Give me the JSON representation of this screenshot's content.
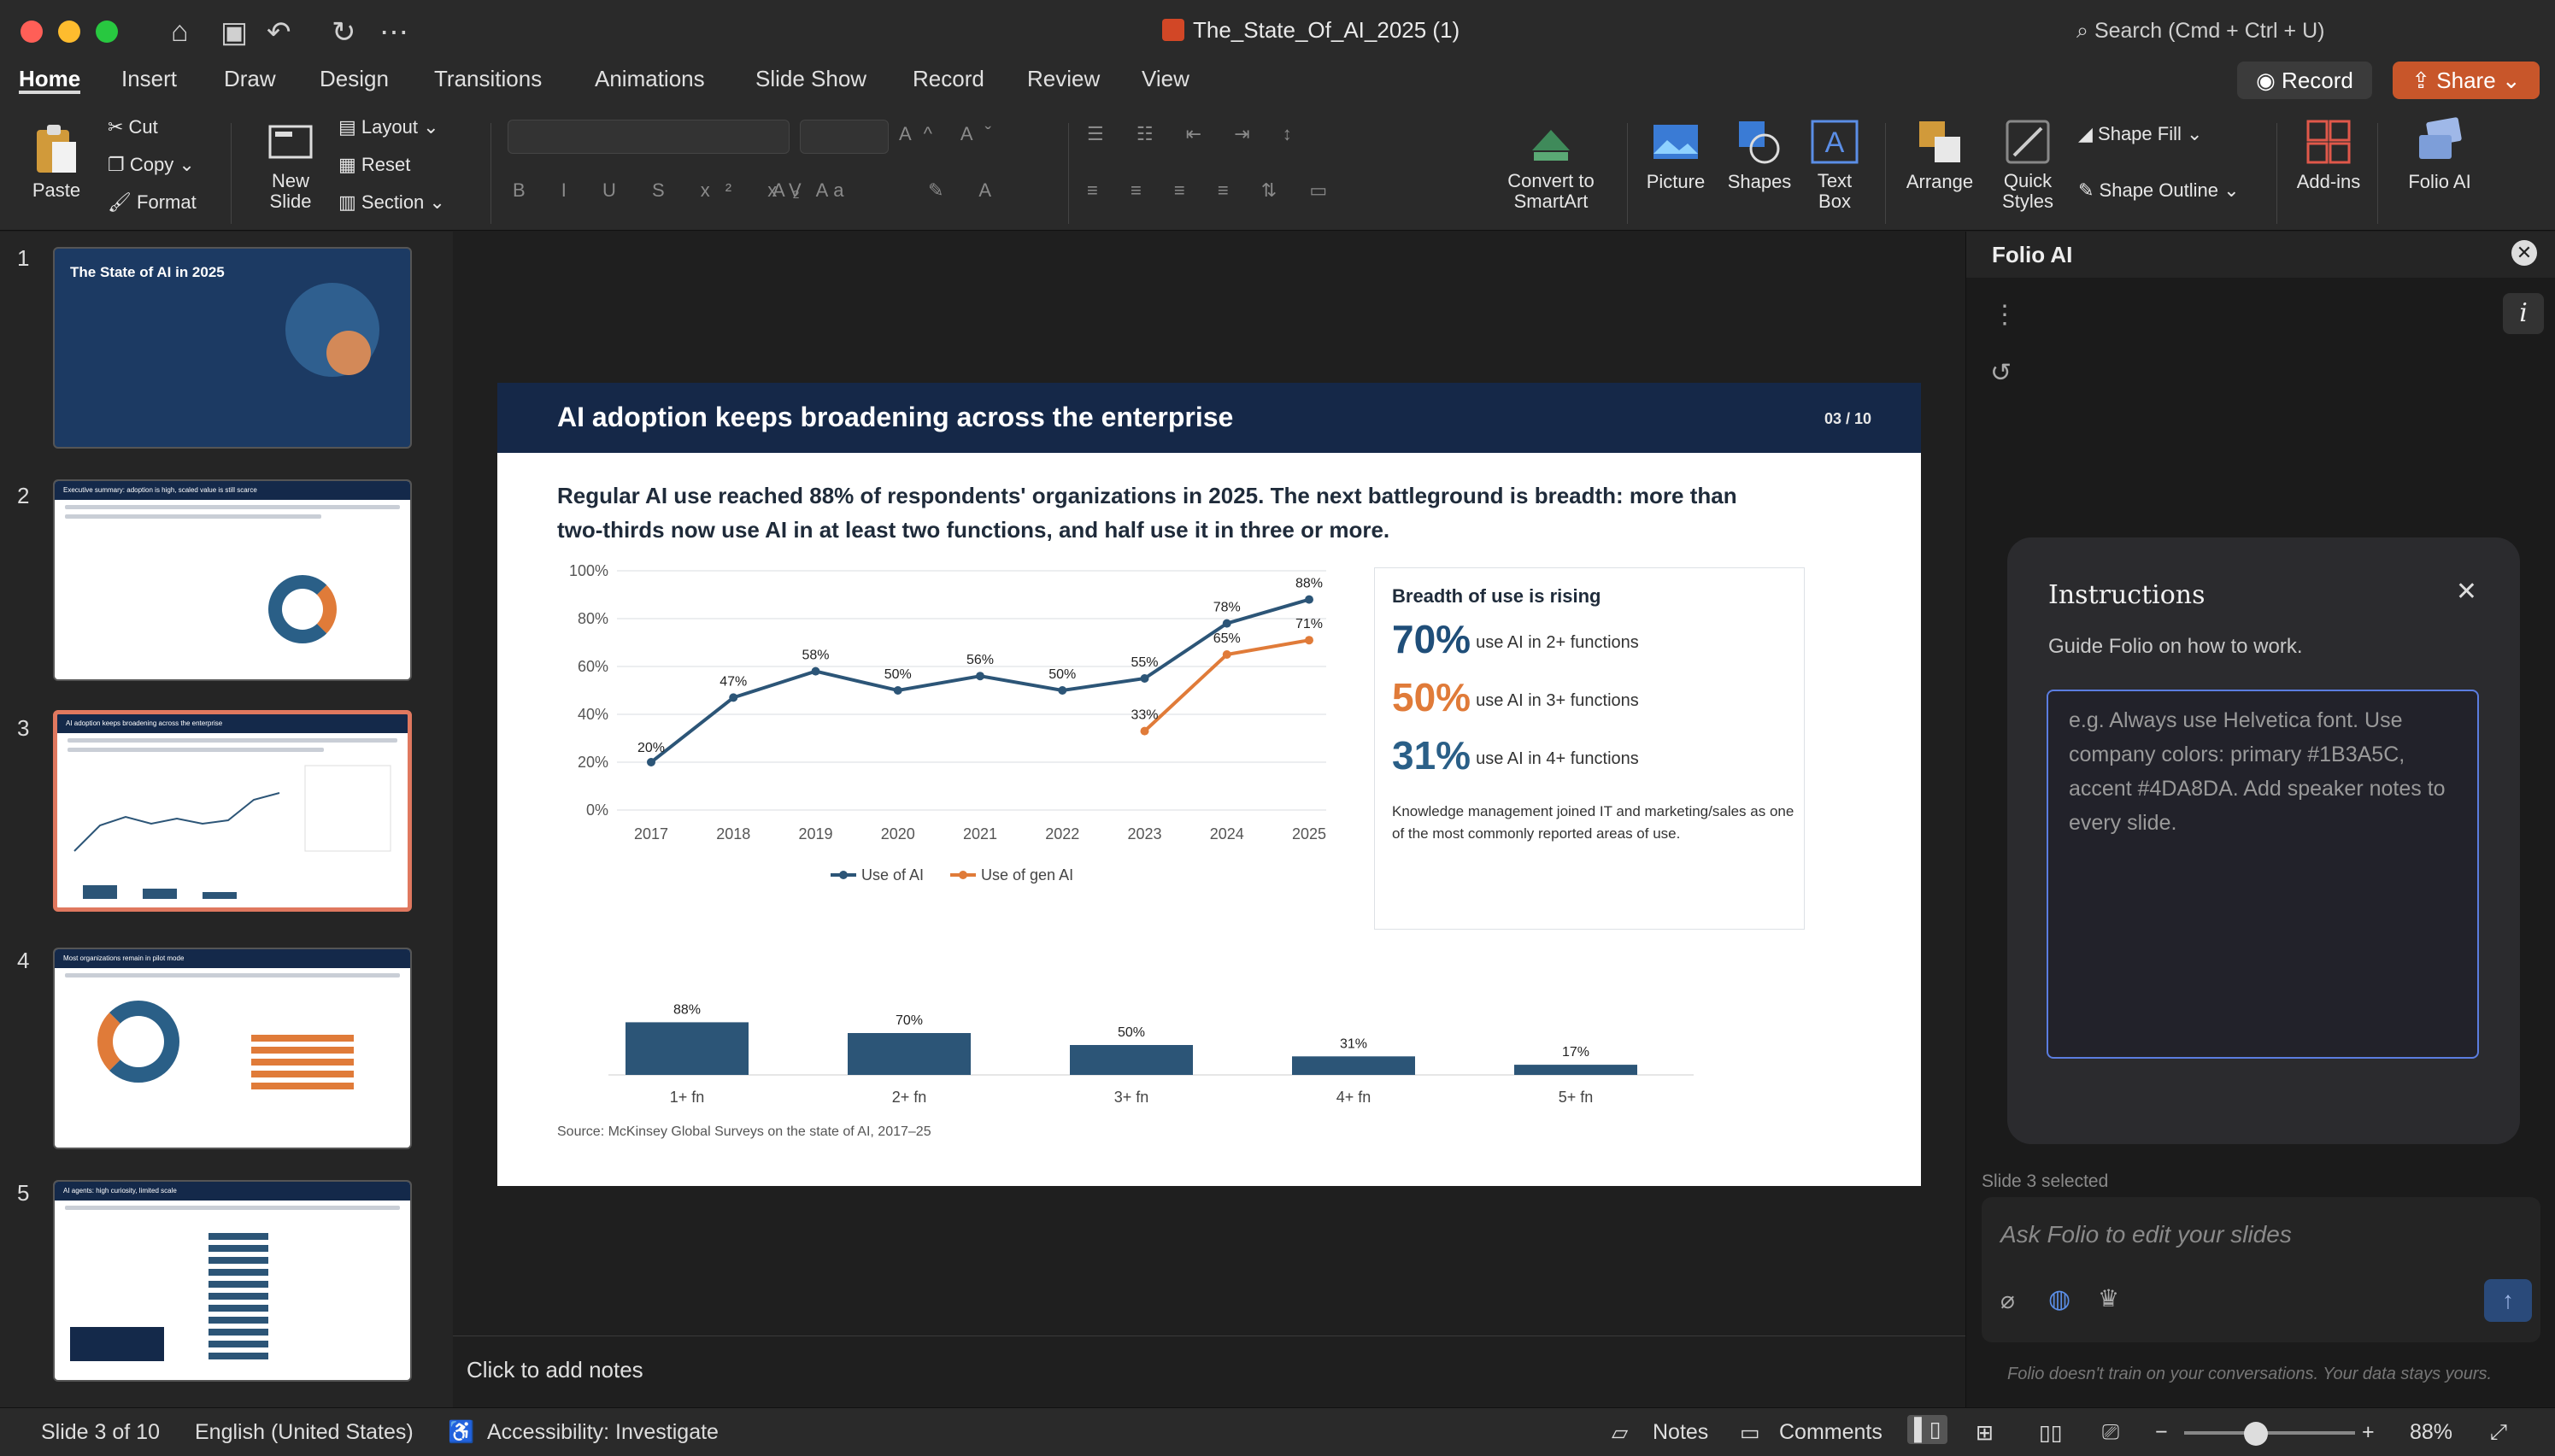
{
  "window": {
    "title": "The_State_Of_AI_2025 (1)",
    "search_placeholder": "Search (Cmd + Ctrl + U)"
  },
  "tabs": [
    "Home",
    "Insert",
    "Draw",
    "Design",
    "Transitions",
    "Animations",
    "Slide Show",
    "Record",
    "Review",
    "View"
  ],
  "header_buttons": {
    "record": "Record",
    "share": "Share"
  },
  "ribbon": {
    "paste": "Paste",
    "cut": "Cut",
    "copy": "Copy",
    "format": "Format",
    "new_slide": "New Slide",
    "layout": "Layout",
    "reset": "Reset",
    "section": "Section",
    "convert": "Convert to SmartArt",
    "picture": "Picture",
    "shapes": "Shapes",
    "text_box": "Text Box",
    "arrange": "Arrange",
    "quick_styles": "Quick Styles",
    "shape_fill": "Shape Fill",
    "shape_outline": "Shape Outline",
    "addins": "Add-ins",
    "folio": "Folio AI"
  },
  "thumbnails": [
    {
      "num": "1",
      "title": "The State of AI in 2025"
    },
    {
      "num": "2",
      "title": "Executive summary: adoption is high, scaled value is still scarce"
    },
    {
      "num": "3",
      "title": "AI adoption keeps broadening across the enterprise"
    },
    {
      "num": "4",
      "title": "Most organizations remain in pilot mode"
    },
    {
      "num": "5",
      "title": "AI agents: high curiosity, limited scale"
    }
  ],
  "slide": {
    "title": "AI adoption keeps broadening across the enterprise",
    "page": "03 / 10",
    "subtitle": "Regular AI use reached 88% of respondents' organizations in 2025. The next battleground is breadth: more than two-thirds now use AI in at least two functions, and half use it in three or more.",
    "source": "Source: McKinsey Global Surveys on the state of AI, 2017–25",
    "breadth": {
      "title": "Breadth of use is rising",
      "stats": [
        {
          "value": "70%",
          "label": "use AI in 2+ functions",
          "color": "#1f4e79"
        },
        {
          "value": "50%",
          "label": "use AI in 3+ functions",
          "color": "#e07b39"
        },
        {
          "value": "31%",
          "label": "use AI in 4+ functions",
          "color": "#2a5f87"
        }
      ],
      "note": "Knowledge management joined IT and marketing/sales as one of the most commonly reported areas of use."
    }
  },
  "chart_data": [
    {
      "type": "line",
      "x": [
        "2017",
        "2018",
        "2019",
        "2020",
        "2021",
        "2022",
        "2023",
        "2024",
        "2025"
      ],
      "ylim": [
        0,
        100
      ],
      "yticks": [
        "0%",
        "20%",
        "40%",
        "60%",
        "80%",
        "100%"
      ],
      "series": [
        {
          "name": "Use of AI",
          "color": "#2c5577",
          "values": [
            20,
            47,
            58,
            50,
            56,
            50,
            55,
            78,
            88
          ],
          "labels": [
            "20%",
            "47%",
            "58%",
            "50%",
            "56%",
            "50%",
            "55%",
            "78%",
            "88%"
          ]
        },
        {
          "name": "Use of gen AI",
          "color": "#e07b39",
          "values": [
            null,
            null,
            null,
            null,
            null,
            null,
            33,
            65,
            71
          ],
          "labels": [
            "",
            "",
            "",
            "",
            "",
            "",
            "33%",
            "65%",
            "71%"
          ]
        }
      ],
      "legend": "bottom"
    },
    {
      "type": "bar",
      "categories": [
        "1+ fn",
        "2+ fn",
        "3+ fn",
        "4+ fn",
        "5+ fn"
      ],
      "values": [
        88,
        70,
        50,
        31,
        17
      ],
      "labels": [
        "88%",
        "70%",
        "50%",
        "31%",
        "17%"
      ],
      "color": "#2c5577"
    }
  ],
  "notes": {
    "placeholder": "Click to add notes"
  },
  "folio": {
    "title": "Folio AI",
    "instructions_title": "Instructions",
    "instructions_sub": "Guide Folio on how to work.",
    "instructions_placeholder": "e.g. Always use Helvetica font. Use company colors: primary #1B3A5C, accent #4DA8DA. Add speaker notes to every slide.",
    "slide_selected": "Slide 3 selected",
    "ask_placeholder": "Ask Folio to edit your slides",
    "disclaimer": "Folio doesn't train on your conversations. Your data stays yours."
  },
  "status": {
    "slide": "Slide 3 of 10",
    "language": "English (United States)",
    "accessibility": "Accessibility: Investigate",
    "notes": "Notes",
    "comments": "Comments",
    "zoom": "88%"
  }
}
